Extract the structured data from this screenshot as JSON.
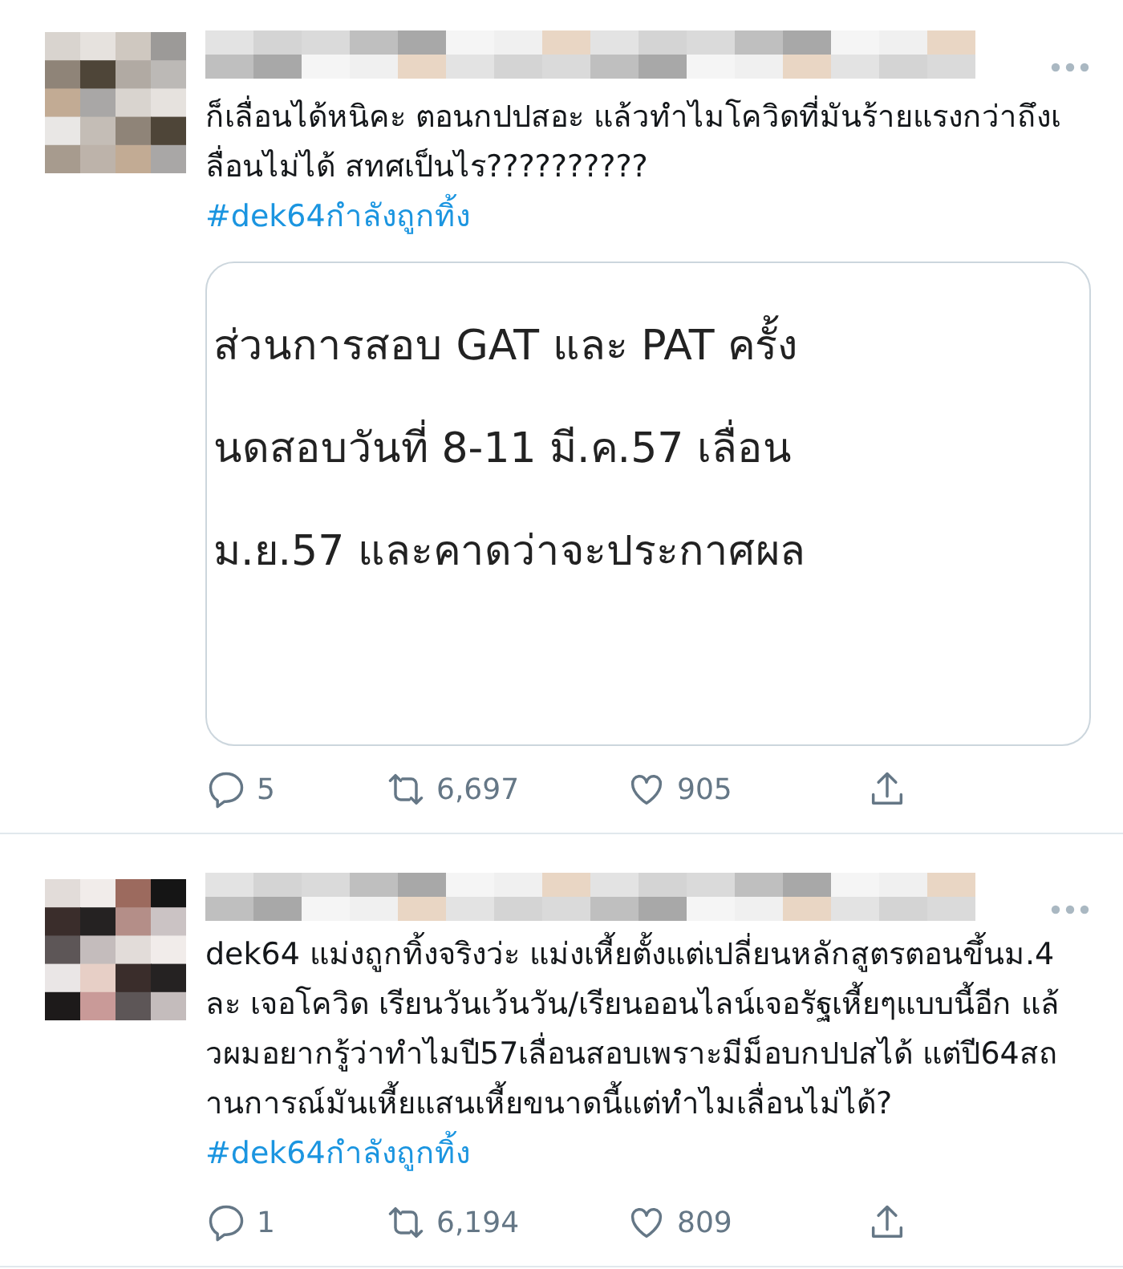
{
  "tweets": [
    {
      "text": "ก็เลื่อนได้หนิคะ ตอนกปปสอะ แล้วทำไมโควิดที่มันร้ายแรงกว่าถึงเลื่อนไม่ได้ สทศเป็นไร??????????",
      "hashtag": "#dek64กำลังถูกทิ้ง",
      "media": {
        "lines": [
          "ส่วนการสอบ GAT และ PAT ครั้ง",
          "นดสอบวันที่ 8-11 มี.ค.57 เลื่อน",
          "ม.ย.57 และคาดว่าจะประกาศผล"
        ]
      },
      "replies": "5",
      "retweets": "6,697",
      "likes": "905"
    },
    {
      "text": "dek64 แม่งถูกทิ้งจริงว่ะ แม่งเหี้ยตั้งแต่เปลี่ยนหลักสูตรตอนขึ้นม.4ละ เจอโควิด เรียนวันเว้นวัน/เรียนออนไลน์เจอรัฐเหี้ยๆแบบนี้อีก แล้วผมอยากรู้ว่าทำไมปี57เลื่อนสอบเพราะมีม็อบกปปสได้ แต่ปี64สถานการณ์มันเหี้ยแสนเหี้ยขนาดนี้แต่ทำไมเลื่อนไม่ได้?",
      "inline_hashtag": "#dek64กำลังถูกทิ้ง",
      "replies": "1",
      "retweets": "6,194",
      "likes": "809"
    }
  ]
}
